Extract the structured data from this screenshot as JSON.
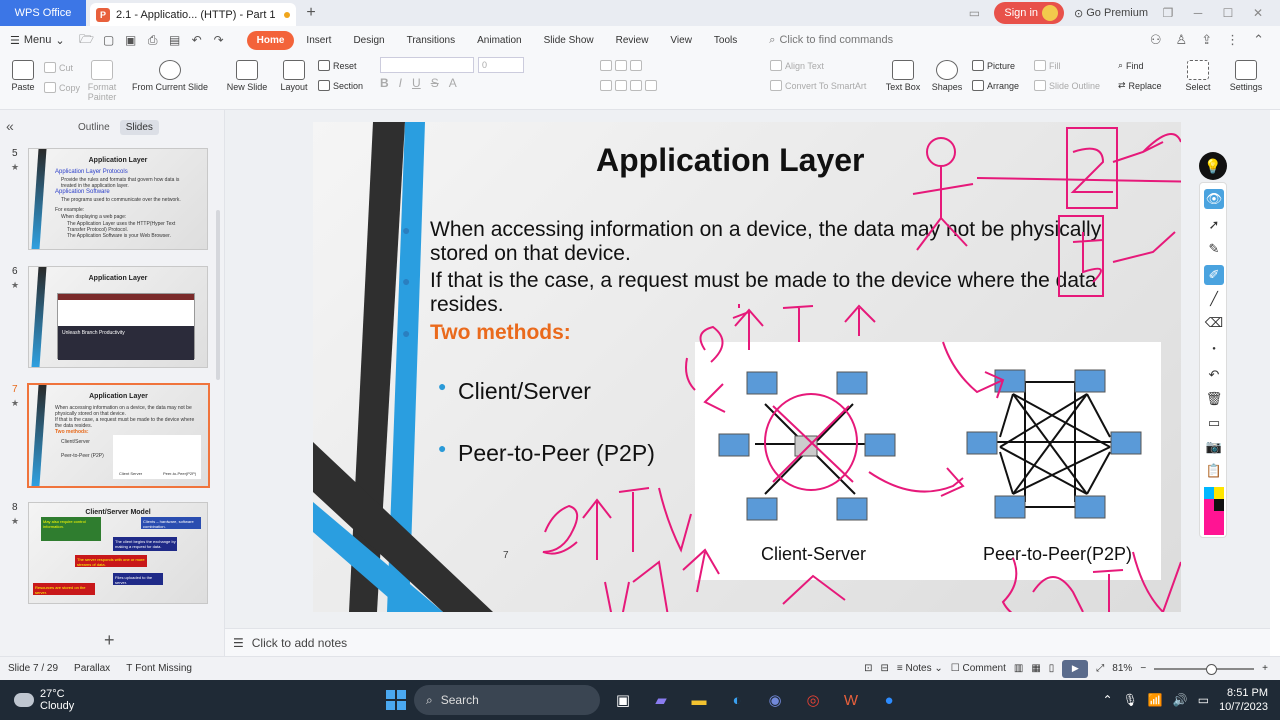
{
  "titlebar": {
    "app_tab": "WPS Office",
    "doc_tab": "2.1 - Applicatio... (HTTP) - Part 1",
    "sign_in": "Sign in",
    "go_premium": "Go Premium"
  },
  "menu": {
    "menu_label": "Menu",
    "tabs": [
      "Home",
      "Insert",
      "Design",
      "Transitions",
      "Animation",
      "Slide Show",
      "Review",
      "View",
      "Tools"
    ],
    "find_commands": "Click to find commands"
  },
  "ribbon": {
    "paste": "Paste",
    "cut": "Cut",
    "copy": "Copy",
    "format_painter": "Format Painter",
    "from_current_slide": "From Current Slide",
    "new_slide": "New Slide",
    "layout": "Layout",
    "reset": "Reset",
    "section": "Section",
    "font_size": "0",
    "align_text": "Align Text",
    "convert_smartart": "Convert To SmartArt",
    "text_box": "Text Box",
    "shapes": "Shapes",
    "picture": "Picture",
    "arrange": "Arrange",
    "fill": "Fill",
    "slide_outline": "Slide Outline",
    "find": "Find",
    "replace": "Replace",
    "select": "Select",
    "settings": "Settings"
  },
  "leftpanel": {
    "view_tabs": [
      "Outline",
      "Slides"
    ],
    "thumbnails": [
      {
        "num": "5",
        "title": "Application Layer",
        "lines": [
          "Application Layer Protocols",
          "Provide the rules and formats that govern how data is",
          "treated in the application layer.",
          "Application Software",
          "The programs used to communicate over the network.",
          "For example:",
          "When displaying a web page:",
          "The Application Layer uses the HTTP(Hyper Text",
          "Transfer Protocol) Protocol.",
          "The Application Software is your Web Browser."
        ]
      },
      {
        "num": "6",
        "title": "Application Layer",
        "lines": [
          "Unleash Branch Productivity"
        ]
      },
      {
        "num": "7",
        "title": "Application Layer",
        "lines": [
          "When accessing information on a device, the data may not be",
          "physically stored on that device.",
          "If that is the case, a request must be made to the device where",
          "the data resides.",
          "Two methods:",
          "Client/Server",
          "Peer-to-Peer (P2P)",
          "Client Server",
          "Peer-to-Peer(P2P)"
        ]
      },
      {
        "num": "8",
        "title": "Client/Server Model",
        "lines": [
          "May also require control information.",
          "Clients – hardware, software combination.",
          "The client begins the exchange by making a request for data.",
          "The server responds with one or more streams of data.",
          "Resources are stored on the server.",
          "Files uploaded to the server."
        ]
      }
    ]
  },
  "slide": {
    "title": "Application Layer",
    "bullets": [
      "When accessing information on a device, the data may not be physically stored on that device.",
      "If that is the case, a request must be made to the device where the data resides.",
      "Two methods:"
    ],
    "sub_bullets": [
      "Client/Server",
      "Peer-to-Peer (P2P)"
    ],
    "slide_number": "7",
    "diagram_labels": [
      "Client-Server",
      "Peer-to-Peer(P2P)"
    ],
    "ink_color": "#e6197a"
  },
  "notes": {
    "placeholder": "Click to add notes"
  },
  "status": {
    "slide_count": "Slide 7 / 29",
    "theme": "Parallax",
    "font_missing": "Font Missing",
    "notes": "Notes",
    "comment": "Comment",
    "zoom": "81%"
  },
  "taskbar": {
    "temp": "27°C",
    "weather": "Cloudy",
    "search": "Search",
    "time": "8:51 PM",
    "date": "10/7/2023"
  }
}
